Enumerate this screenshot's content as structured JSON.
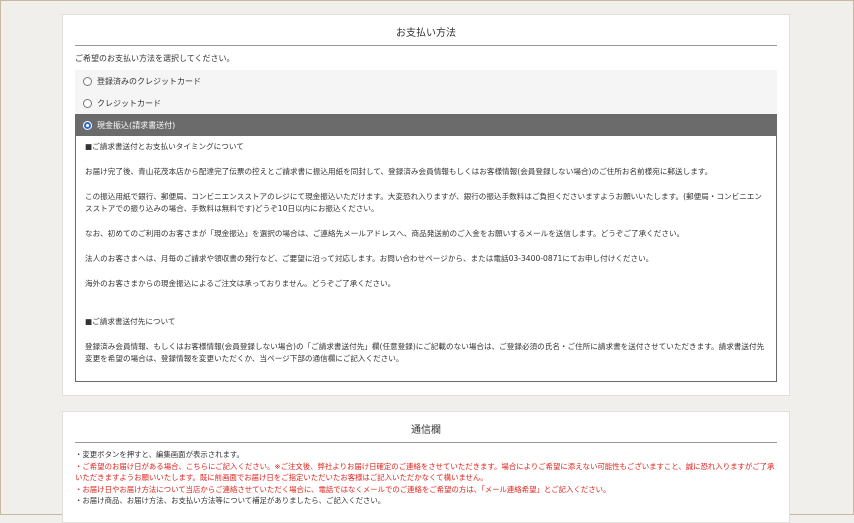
{
  "payment": {
    "title": "お支払い方法",
    "intro": "ご希望のお支払い方法を選択してください。",
    "options": [
      {
        "label": "登録済みのクレジットカード",
        "selected": false
      },
      {
        "label": "クレジットカード",
        "selected": false
      },
      {
        "label": "現金振込(請求書送付)",
        "selected": true
      }
    ],
    "detail": {
      "heading1": "■ご請求書送付とお支払いタイミングについて",
      "p1": "お届け完了後、青山花茂本店から配達完了伝票の控えとご請求書に振込用紙を同封して、登録済み会員情報もしくはお客様情報(会員登録しない場合)のご住所お名前様宛に郵送します。",
      "p2": "この振込用紙で銀行、郵便局、コンビニエンスストアのレジにて現金振込いただけます。大変恐れ入りますが、銀行の振込手数料はご負担くださいますようお願いいたします。(郵便局・コンビニエンスストアでの振り込みの場合、手数料は無料です)どうぞ10日以内にお振込ください。",
      "p3": "なお、初めてのご利用のお客さまが「現金振込」を選択の場合は、ご連絡先メールアドレスへ、商品発送前のご入金をお願いするメールを送信します。どうぞご了承ください。",
      "p4": "法人のお客さまへは、月毎のご請求や領収書の発行など、ご要望に沿って対応します。お問い合わせページから、または電話03-3400-0871にてお申し付けください。",
      "p5": "海外のお客さまからの現金振込によるご注文は承っておりません。どうぞご了承ください。",
      "heading2": "■ご請求書送付先について",
      "p6": "登録済み会員情報、もしくはお客様情報(会員登録しない場合)の「ご請求書送付先」欄(任意登録)にご記載のない場合は、ご登録必須の氏名・ご住所に請求書を送付させていただきます。請求書送付先変更を希望の場合は、登録情報を変更いただくか、当ページ下部の通信欄にご記入ください。"
    }
  },
  "notes": {
    "title": "通信欄",
    "line1": "・変更ボタンを押すと、編集画面が表示されます。",
    "line2": "・ご希望のお届け日がある場合、こちらにご記入ください。※ご注文後、弊社よりお届け日確定のご連絡をさせていただきます。場合によりご希望に添えない可能性もございますこと、誠に恐れ入りますがご了承いただきますようお願いいたします。既に前画面でお届け日をご指定いただいたお客様はご記入いただかなくて構いません。",
    "line3": "・お届け日やお届け方法について当店からご連絡させていただく場合に、電話ではなくメールでのご連絡をご希望の方は、「メール連絡希望」とご記入ください。",
    "line4": "・お届け商品、お届け方法、お支払い方法等について補足がありましたら、ご記入ください。"
  },
  "colors": {
    "accent_red": "#e0221a",
    "selected_bg": "#6b6b6b",
    "radio_selected": "#2d6ad6"
  }
}
